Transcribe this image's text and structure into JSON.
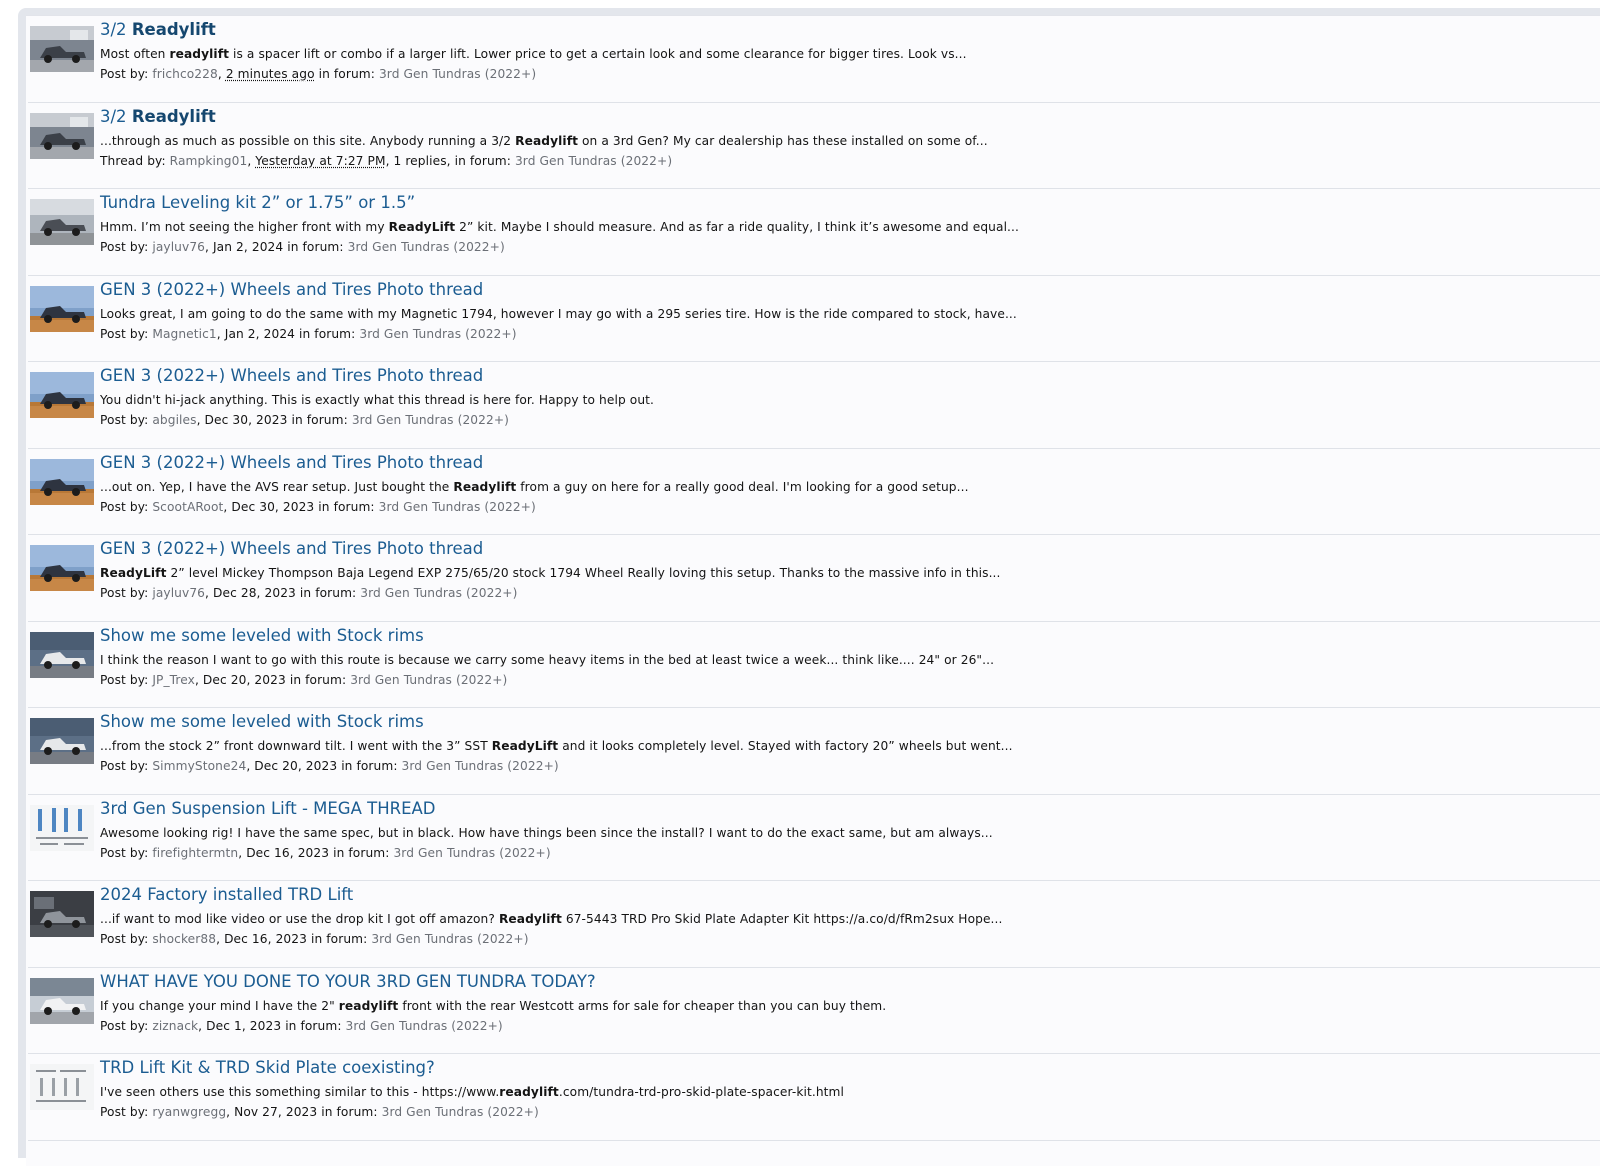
{
  "results": [
    {
      "thumb": "truck-showroom",
      "title": [
        {
          "t": "3/2 "
        },
        {
          "t": "Readylift",
          "b": true
        }
      ],
      "snippet": [
        {
          "t": "Most often "
        },
        {
          "t": "readylift",
          "b": true
        },
        {
          "t": " is a spacer lift or combo if a larger lift. Lower price to get a certain look and some clearance for bigger tires. Look vs..."
        }
      ],
      "kind": "Post by:",
      "author": "frichco228",
      "time": "2 minutes ago",
      "replies": "",
      "forum_label": "in forum:",
      "forum": "3rd Gen Tundras (2022+)"
    },
    {
      "thumb": "truck-showroom",
      "title": [
        {
          "t": "3/2 "
        },
        {
          "t": "Readylift",
          "b": true
        }
      ],
      "snippet": [
        {
          "t": "...through as much as possible on this site. Anybody running a 3/2 "
        },
        {
          "t": "Readylift",
          "b": true
        },
        {
          "t": " on a 3rd Gen? My car dealership has these installed on some of..."
        }
      ],
      "kind": "Thread by:",
      "author": "Rampking01",
      "time": "Yesterday at 7:27 PM",
      "replies": "1 replies,",
      "forum_label": "in forum:",
      "forum": "3rd Gen Tundras (2022+)"
    },
    {
      "thumb": "truck-gray",
      "title": [
        {
          "t": "Tundra Leveling kit 2” or 1.75” or 1.5”"
        }
      ],
      "snippet": [
        {
          "t": "Hmm. I’m not seeing the higher front with my "
        },
        {
          "t": "ReadyLift",
          "b": true
        },
        {
          "t": " 2” kit. Maybe I should measure. And as far a ride quality, I think it’s awesome and equal..."
        }
      ],
      "kind": "Post by:",
      "author": "jayluv76",
      "time": "Jan 2, 2024",
      "replies": "",
      "forum_label": "in forum:",
      "forum": "3rd Gen Tundras (2022+)"
    },
    {
      "thumb": "truck-field",
      "title": [
        {
          "t": "GEN 3 (2022+) Wheels and Tires Photo thread"
        }
      ],
      "snippet": [
        {
          "t": "Looks great, I am going to do the same with my Magnetic 1794, however I may go with a 295 series tire. How is the ride compared to stock, have..."
        }
      ],
      "kind": "Post by:",
      "author": "Magnetic1",
      "time": "Jan 2, 2024",
      "replies": "",
      "forum_label": "in forum:",
      "forum": "3rd Gen Tundras (2022+)"
    },
    {
      "thumb": "truck-field",
      "title": [
        {
          "t": "GEN 3 (2022+) Wheels and Tires Photo thread"
        }
      ],
      "snippet": [
        {
          "t": "You didn't hi-jack anything. This is exactly what this thread is here for. Happy to help out."
        }
      ],
      "kind": "Post by:",
      "author": "abgiles",
      "time": "Dec 30, 2023",
      "replies": "",
      "forum_label": "in forum:",
      "forum": "3rd Gen Tundras (2022+)"
    },
    {
      "thumb": "truck-field",
      "title": [
        {
          "t": "GEN 3 (2022+) Wheels and Tires Photo thread"
        }
      ],
      "snippet": [
        {
          "t": "...out on. Yep, I have the AVS rear setup. Just bought the "
        },
        {
          "t": "Readylift",
          "b": true
        },
        {
          "t": " from a guy on here for a really good deal. I'm looking for a good setup..."
        }
      ],
      "kind": "Post by:",
      "author": "ScootARoot",
      "time": "Dec 30, 2023",
      "replies": "",
      "forum_label": "in forum:",
      "forum": "3rd Gen Tundras (2022+)"
    },
    {
      "thumb": "truck-field",
      "title": [
        {
          "t": "GEN 3 (2022+) Wheels and Tires Photo thread"
        }
      ],
      "snippet": [
        {
          "t": "ReadyLift",
          "b": true
        },
        {
          "t": " 2” level Mickey Thompson Baja Legend EXP 275/65/20 stock 1794 Wheel Really loving this setup. Thanks to the massive info in this..."
        }
      ],
      "kind": "Post by:",
      "author": "jayluv76",
      "time": "Dec 28, 2023",
      "replies": "",
      "forum_label": "in forum:",
      "forum": "3rd Gen Tundras (2022+)"
    },
    {
      "thumb": "truck-white",
      "title": [
        {
          "t": "Show me some leveled with Stock rims"
        }
      ],
      "snippet": [
        {
          "t": "I think the reason I want to go with this route is because we carry some heavy items in the bed at least twice a week... think like.... 24\" or 26\"..."
        }
      ],
      "kind": "Post by:",
      "author": "JP_Trex",
      "time": "Dec 20, 2023",
      "replies": "",
      "forum_label": "in forum:",
      "forum": "3rd Gen Tundras (2022+)"
    },
    {
      "thumb": "truck-white",
      "title": [
        {
          "t": "Show me some leveled with Stock rims"
        }
      ],
      "snippet": [
        {
          "t": "...from the stock 2” front downward tilt. I went with the 3” SST "
        },
        {
          "t": "ReadyLift",
          "b": true
        },
        {
          "t": " and it looks completely level. Stayed with factory 20” wheels but went..."
        }
      ],
      "kind": "Post by:",
      "author": "SimmyStone24",
      "time": "Dec 20, 2023",
      "replies": "",
      "forum_label": "in forum:",
      "forum": "3rd Gen Tundras (2022+)"
    },
    {
      "thumb": "parts-kit",
      "title": [
        {
          "t": "3rd Gen Suspension Lift - MEGA THREAD"
        }
      ],
      "snippet": [
        {
          "t": "Awesome looking rig! I have the same spec, but in black. How have things been since the install? I want to do the exact same, but am always..."
        }
      ],
      "kind": "Post by:",
      "author": "firefightermtn",
      "time": "Dec 16, 2023",
      "replies": "",
      "forum_label": "in forum:",
      "forum": "3rd Gen Tundras (2022+)"
    },
    {
      "thumb": "truck-interior",
      "title": [
        {
          "t": "2024 Factory installed TRD Lift"
        }
      ],
      "snippet": [
        {
          "t": "...if want to mod like video or use the drop kit I got off amazon? "
        },
        {
          "t": "Readylift",
          "b": true
        },
        {
          "t": " 67-5443 TRD Pro Skid Plate Adapter Kit https://a.co/d/fRm2sux Hope..."
        }
      ],
      "kind": "Post by:",
      "author": "shocker88",
      "time": "Dec 16, 2023",
      "replies": "",
      "forum_label": "in forum:",
      "forum": "3rd Gen Tundras (2022+)"
    },
    {
      "thumb": "truck-white2",
      "title": [
        {
          "t": "WHAT HAVE YOU DONE TO YOUR 3RD GEN TUNDRA TODAY?"
        }
      ],
      "snippet": [
        {
          "t": "If you change your mind I have the 2\" "
        },
        {
          "t": "readylift",
          "b": true
        },
        {
          "t": " front with the rear Westcott arms for sale for cheaper than you can buy them."
        }
      ],
      "kind": "Post by:",
      "author": "ziznack",
      "time": "Dec 1, 2023",
      "replies": "",
      "forum_label": "in forum:",
      "forum": "3rd Gen Tundras (2022+)"
    },
    {
      "thumb": "parts-kit2",
      "title": [
        {
          "t": "TRD Lift Kit & TRD Skid Plate coexisting?"
        }
      ],
      "snippet": [
        {
          "t": "I've seen others use this something similar to this - https://www."
        },
        {
          "t": "readylift",
          "b": true
        },
        {
          "t": ".com/tundra-trd-pro-skid-plate-spacer-kit.html"
        }
      ],
      "kind": "Post by:",
      "author": "ryanwgregg",
      "time": "Nov 27, 2023",
      "replies": "",
      "forum_label": "in forum:",
      "forum": "3rd Gen Tundras (2022+)"
    }
  ]
}
